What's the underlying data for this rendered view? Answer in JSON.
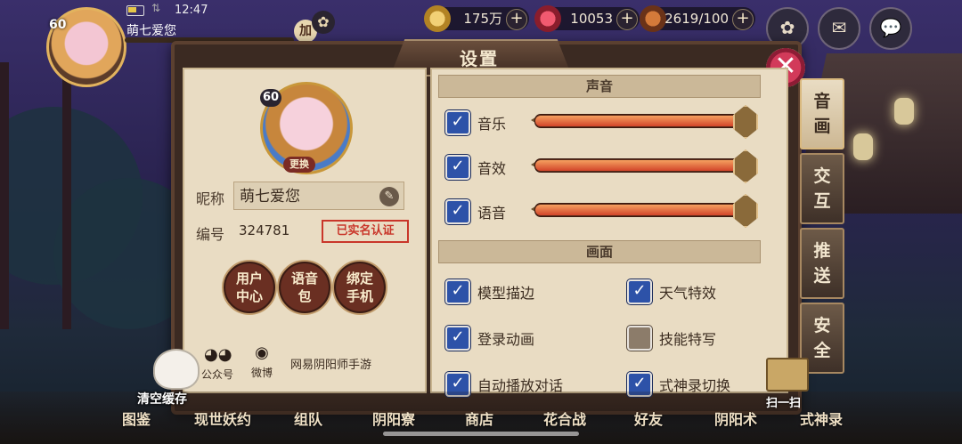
{
  "status": {
    "time": "12:47",
    "arrows": "⇅"
  },
  "player": {
    "name": "萌七爱您",
    "level": "60"
  },
  "top_misc": {
    "add": "加",
    "shuriken": "✿"
  },
  "resources": [
    {
      "value": "175万",
      "plus": "+",
      "color": "#c89a3a"
    },
    {
      "value": "10053",
      "plus": "+",
      "color": "#c8334a"
    },
    {
      "value": "2619/100",
      "plus": "+",
      "color": "#b5582a"
    }
  ],
  "dialog": {
    "title": "设置",
    "close": "✕"
  },
  "profile": {
    "level": "60",
    "change": "更换",
    "nickname_label": "昵称",
    "nickname": "萌七爱您",
    "id_label": "编号",
    "id_value": "324781",
    "verified": "已实名认证",
    "buttons": [
      "用户\n中心",
      "语音\n包",
      "绑定\n手机"
    ],
    "social": [
      {
        "icon": "wechat-icon",
        "label": "公众号"
      },
      {
        "icon": "weibo-icon",
        "label": "微博"
      }
    ],
    "game_name": "网易阴阳师手游"
  },
  "sound": {
    "header": "声音",
    "items": [
      {
        "label": "音乐",
        "checked": true,
        "level": 1.0
      },
      {
        "label": "音效",
        "checked": true,
        "level": 1.0
      },
      {
        "label": "语音",
        "checked": true,
        "level": 1.0
      }
    ]
  },
  "graphics": {
    "header": "画面",
    "items": [
      {
        "label": "模型描边",
        "checked": true
      },
      {
        "label": "天气特效",
        "checked": true
      },
      {
        "label": "登录动画",
        "checked": true
      },
      {
        "label": "技能特写",
        "checked": false
      },
      {
        "label": "自动播放对话",
        "checked": true
      },
      {
        "label": "式神录切换",
        "checked": true
      }
    ]
  },
  "side_tabs": [
    {
      "label": "音\n画",
      "active": true
    },
    {
      "label": "交\n互",
      "active": false
    },
    {
      "label": "推\n送",
      "active": false
    },
    {
      "label": "安\n全",
      "active": false
    }
  ],
  "clear_cache": "清空缓存",
  "scan": "扫一扫",
  "bottom_nav": [
    "图鉴",
    "现世妖约",
    "组队",
    "阴阳寮",
    "商店",
    "花合战",
    "好友",
    "阴阳术",
    "式神录"
  ]
}
